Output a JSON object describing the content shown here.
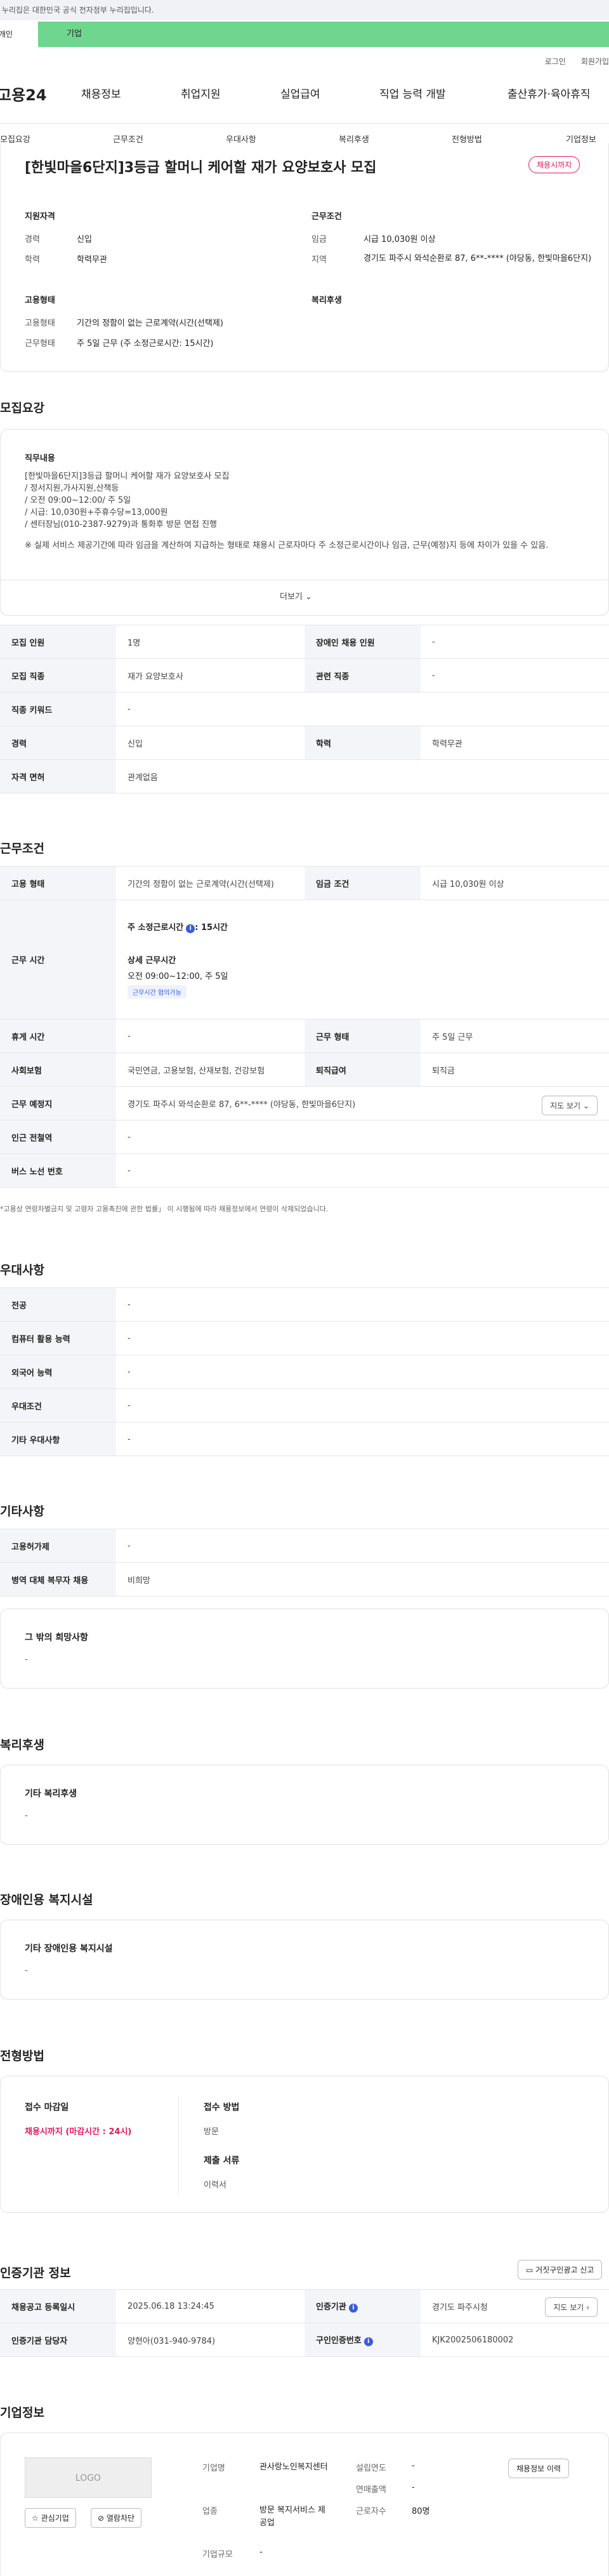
{
  "gov_banner": "이 누리집은 대한민국 공식 전자정부 누리집입니다.",
  "segment": {
    "personal": "개인",
    "company": "기업"
  },
  "util": {
    "login": "로그인",
    "signup": "회원가입"
  },
  "logo": "고용24",
  "nav": [
    "채용정보",
    "취업지원",
    "실업급여",
    "직업 능력 개발",
    "출산휴가·육아휴직"
  ],
  "subnav": [
    "모집요강",
    "근무조건",
    "우대사항",
    "복리후생",
    "전형방법",
    "기업정보"
  ],
  "job": {
    "title": "[한빛마을6단지]3등급 할머니 케어할 재가 요양보호사 모집",
    "status_badge": "채용시까지",
    "qual_title": "지원자격",
    "career_label": "경력",
    "career_value": "신입",
    "edu_label": "학력",
    "edu_value": "학력무관",
    "cond_title": "근무조건",
    "wage_label": "임금",
    "wage_value": "시급 10,030원 이상",
    "area_label": "지역",
    "area_value": "경기도 파주시 와석순환로 87, 6**-**** (야당동, 한빛마을6단지)",
    "emp_title": "고용형태",
    "emp_type_label": "고용형태",
    "emp_type_value": "기간의 정함이 없는 근로계약(시간(선택제)",
    "work_type_label": "근무형태",
    "work_type_value": "주 5일 근무 (주 소정근로시간: 15시간)",
    "welfare_title": "복리후생"
  },
  "recruit": {
    "section_title": "모집요강",
    "duty_title": "직무내용",
    "duty_lines": [
      "[한빛마을6단지]3등급 할머니 케어할 재가 요양보호사 모집",
      "/ 정서지원,가사지원,산책등",
      "/ 오전 09:00~12:00/ 주 5일",
      "/ 시급: 10,030원+주휴수당=13,000원",
      "/ 센터장님(010-2387-9279)과 통화후 방문 면접 진행"
    ],
    "duty_note": "※ 실제 서비스 제공기간에 따라 임금을 계산하여 지급하는 형태로 채용시 근로자마다 주 소정근로시간이나 임금, 근무(예정)지 등에 차이가 있을 수 있음.",
    "more": "더보기",
    "rows": [
      [
        "모집 인원",
        "1명",
        "장애인 채용 인원",
        "-"
      ],
      [
        "모집 직종",
        "재가 요양보호사",
        "관련 직종",
        "-"
      ],
      [
        "직종 키워드",
        "-"
      ],
      [
        "경력",
        "신입",
        "학력",
        "학력무관"
      ],
      [
        "자격 면허",
        "관계없음"
      ]
    ]
  },
  "workcond": {
    "section_title": "근무조건",
    "emp_label": "고용 형태",
    "emp_value": "기간의 정함이 없는 근로계약(시간(선택제)",
    "wage_label": "임금 조건",
    "wage_value": "시급 10,030원 이상",
    "hours_label": "근무 시간",
    "hours_week": "주 소정근로시간",
    "hours_week_value": ": 15시간",
    "hours_detail_title": "상세 근무시간",
    "hours_detail": "오전 09:00~12:00, 주 5일",
    "hours_chip": "근무시간 협의가능",
    "rest_label": "휴게 시간",
    "rest_value": "-",
    "form_label": "근무 형태",
    "form_value": "주 5일 근무",
    "insure_label": "사회보험",
    "insure_value": "국민연금, 고용보험, 산재보험, 건강보험",
    "retire_label": "퇴직급여",
    "retire_value": "퇴직금",
    "place_label": "근무 예정지",
    "place_value": "경기도 파주시 와석순환로 87, 6**-**** (야당동, 한빛마을6단지)",
    "map_btn": "지도 보기",
    "station_label": "인근 전철역",
    "station_value": "-",
    "bus_label": "버스 노선 번호",
    "bus_value": "-",
    "note": "*고용상 연령차별금지 및 고령자 고용촉진에 관한 법률」 이 시행됨에 따라 채용정보에서 연령이 삭제되었습니다."
  },
  "pref": {
    "section_title": "우대사항",
    "rows": [
      [
        "전공",
        "-"
      ],
      [
        "컴퓨터 활용 능력",
        "-"
      ],
      [
        "외국어 능력",
        "-"
      ],
      [
        "우대조건",
        "-"
      ],
      [
        "기타 우대사항",
        "-"
      ]
    ]
  },
  "etc": {
    "section_title": "기타사항",
    "rows": [
      [
        "고용허가제",
        "-"
      ],
      [
        "병역 대체 복무자 채용",
        "비희망"
      ]
    ],
    "other_title": "그 밖의 희망사항",
    "other_value": "-"
  },
  "welfare": {
    "section_title": "복리후생",
    "sub_title": "기타 복리후생",
    "value": "-"
  },
  "disabled": {
    "section_title": "장애인용 복지시설",
    "sub_title": "기타 장애인용 복지시설",
    "value": "-"
  },
  "selection": {
    "section_title": "전형방법",
    "deadline_title": "접수 마감일",
    "deadline_value": "채용시까지 (마감시간 : 24시)",
    "method_title": "접수 방법",
    "method_value": "방문",
    "doc_title": "제출 서류",
    "doc_value": "이력서"
  },
  "agency": {
    "section_title": "인증기관 정보",
    "report_btn": "거짓구인광고 신고",
    "reg_label": "채용공고 등록일시",
    "reg_value": "2025.06.18 13:24:45",
    "org_label": "인증기관",
    "org_value": "경기도 파주시청",
    "map_btn": "지도 보기",
    "mgr_label": "인증기관 담당자",
    "mgr_value": "양현아(031-940-9784)",
    "id_label": "구인인증번호",
    "id_value": "KJK2002506180002"
  },
  "company": {
    "section_title": "기업정보",
    "logo_text": "LOGO",
    "fav_btn": "관심기업",
    "block_btn": "열람차단",
    "name_label": "기업명",
    "name_value": "관사랑노인복지센터",
    "found_label": "설립연도",
    "found_value": "-",
    "sales_label": "연매출액",
    "sales_value": "-",
    "industry_label": "업종",
    "industry_value": "방문 복지서비스 제공업",
    "staff_label": "근로자수",
    "staff_value": "80명",
    "scale_label": "기업규모",
    "scale_value": "-",
    "history_btn": "채용정보 이력"
  }
}
